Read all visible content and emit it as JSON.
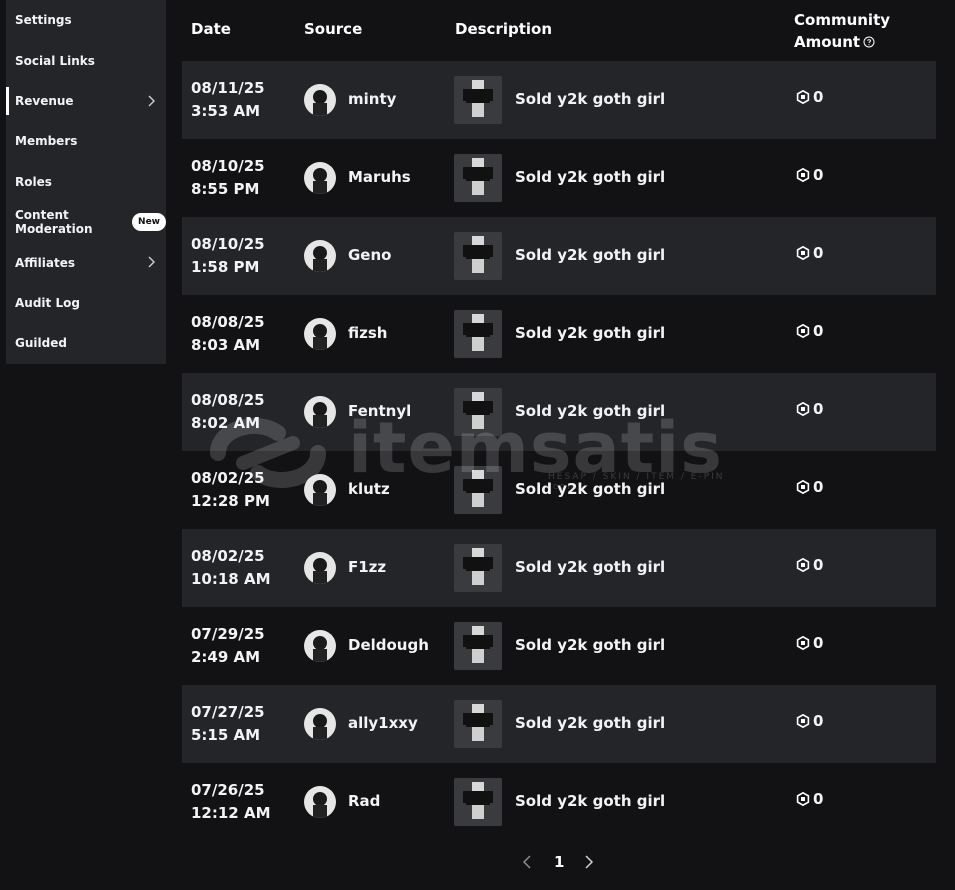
{
  "sidebar": {
    "items": [
      {
        "label": "Settings"
      },
      {
        "label": "Social Links"
      },
      {
        "label": "Revenue"
      },
      {
        "label": "Members"
      },
      {
        "label": "Roles"
      },
      {
        "label": "Content Moderation",
        "badge": "New"
      },
      {
        "label": "Affiliates"
      },
      {
        "label": "Audit Log"
      },
      {
        "label": "Guilded"
      }
    ],
    "active_item": "Revenue"
  },
  "table": {
    "headers": {
      "date": "Date",
      "source": "Source",
      "description": "Description",
      "amount_line1": "Community",
      "amount_line2": "Amount"
    },
    "rows": [
      {
        "date": "08/11/25",
        "time": "3:53 AM",
        "source": "minty",
        "description": "Sold y2k goth girl",
        "amount": "0"
      },
      {
        "date": "08/10/25",
        "time": "8:55 PM",
        "source": "Maruhs",
        "description": "Sold y2k goth girl",
        "amount": "0"
      },
      {
        "date": "08/10/25",
        "time": "1:58 PM",
        "source": "Geno",
        "description": "Sold y2k goth girl",
        "amount": "0"
      },
      {
        "date": "08/08/25",
        "time": "8:03 AM",
        "source": "fizsh",
        "description": "Sold y2k goth girl",
        "amount": "0"
      },
      {
        "date": "08/08/25",
        "time": "8:02 AM",
        "source": "Fentnyl",
        "description": "Sold y2k goth girl",
        "amount": "0"
      },
      {
        "date": "08/02/25",
        "time": "12:28 PM",
        "source": "klutz",
        "description": "Sold y2k goth girl",
        "amount": "0"
      },
      {
        "date": "08/02/25",
        "time": "10:18 AM",
        "source": "F1zz",
        "description": "Sold y2k goth girl",
        "amount": "0"
      },
      {
        "date": "07/29/25",
        "time": "2:49 AM",
        "source": "Deldough",
        "description": "Sold y2k goth girl",
        "amount": "0"
      },
      {
        "date": "07/27/25",
        "time": "5:15 AM",
        "source": "ally1xxy",
        "description": "Sold y2k goth girl",
        "amount": "0"
      },
      {
        "date": "07/26/25",
        "time": "12:12 AM",
        "source": "Rad",
        "description": "Sold y2k goth girl",
        "amount": "0"
      }
    ]
  },
  "pagination": {
    "current_page": "1"
  },
  "watermark": {
    "text": "itemsatis",
    "sub": "HESAP / SKIN / ITEM / E-PIN",
    "domain": ".com"
  },
  "icons": {
    "currency": "robux-icon",
    "help": "help-circle-icon",
    "chevron": "chevron-right-icon",
    "prev": "chevron-left-icon",
    "next": "chevron-right-icon"
  },
  "colors": {
    "background": "#121215",
    "row_alt": "#232529",
    "sidebar": "#232529",
    "text": "#ffffff"
  }
}
